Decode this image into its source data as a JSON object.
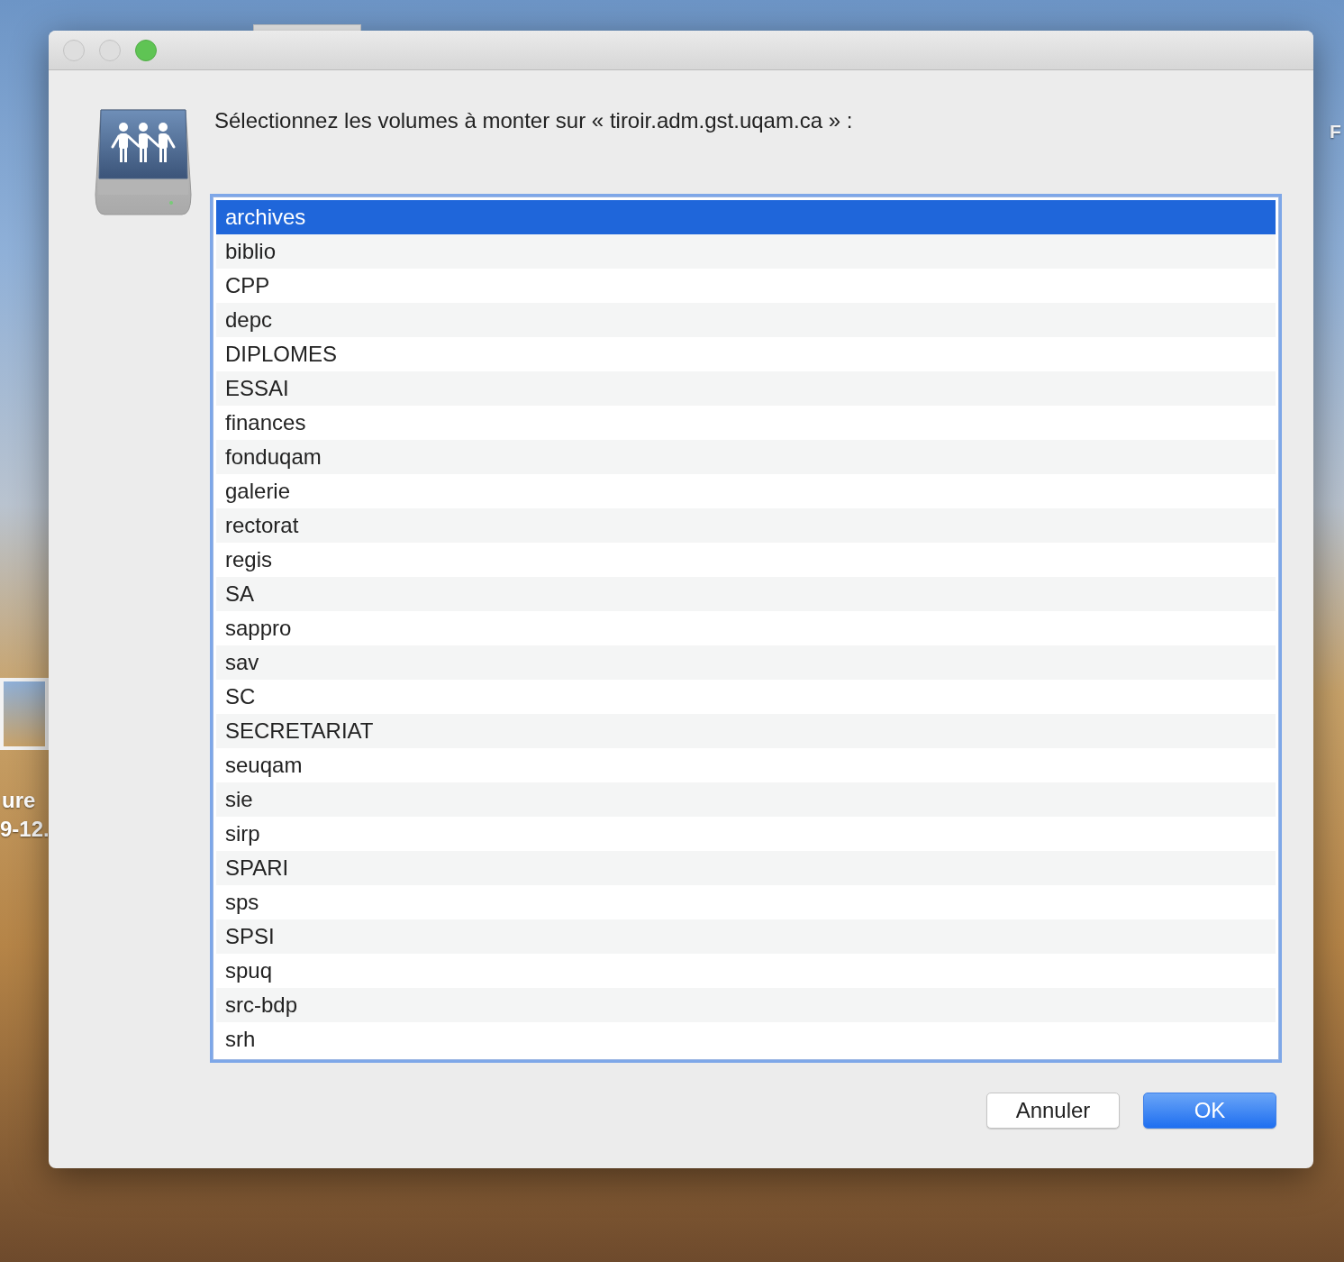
{
  "desktop": {
    "labels": [
      "ure",
      "9-12.",
      "F"
    ]
  },
  "dialog": {
    "prompt": "Sélectionnez les volumes à monter sur « tiroir.adm.gst.uqam.ca » :",
    "volumes": [
      {
        "name": "archives",
        "selected": true
      },
      {
        "name": "biblio",
        "selected": false
      },
      {
        "name": "CPP",
        "selected": false
      },
      {
        "name": "depc",
        "selected": false
      },
      {
        "name": "DIPLOMES",
        "selected": false
      },
      {
        "name": "ESSAI",
        "selected": false
      },
      {
        "name": "finances",
        "selected": false
      },
      {
        "name": "fonduqam",
        "selected": false
      },
      {
        "name": "galerie",
        "selected": false
      },
      {
        "name": "rectorat",
        "selected": false
      },
      {
        "name": "regis",
        "selected": false
      },
      {
        "name": "SA",
        "selected": false
      },
      {
        "name": "sappro",
        "selected": false
      },
      {
        "name": "sav",
        "selected": false
      },
      {
        "name": "SC",
        "selected": false
      },
      {
        "name": "SECRETARIAT",
        "selected": false
      },
      {
        "name": "seuqam",
        "selected": false
      },
      {
        "name": "sie",
        "selected": false
      },
      {
        "name": "sirp",
        "selected": false
      },
      {
        "name": "SPARI",
        "selected": false
      },
      {
        "name": "sps",
        "selected": false
      },
      {
        "name": "SPSI",
        "selected": false
      },
      {
        "name": "spuq",
        "selected": false
      },
      {
        "name": "src-bdp",
        "selected": false
      },
      {
        "name": "srh",
        "selected": false
      }
    ],
    "buttons": [
      {
        "label": "Annuler",
        "kind": "cancel"
      },
      {
        "label": "OK",
        "kind": "default"
      }
    ]
  }
}
